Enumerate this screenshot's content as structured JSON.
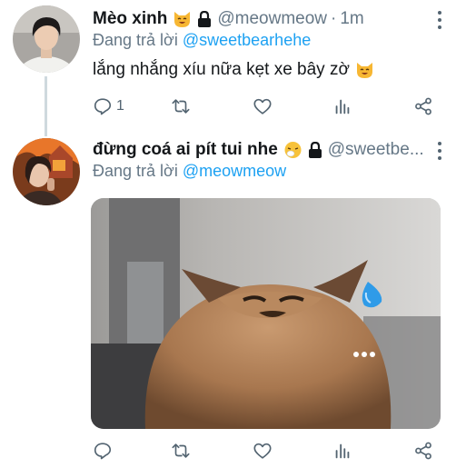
{
  "tweets": [
    {
      "author_name": "Mèo xinh",
      "author_emoji": "cat-face-icon",
      "protected_icon": "lock-icon",
      "handle": "@meowmeow",
      "separator": "·",
      "time": "1m",
      "reply_prefix": "Đang trả lời",
      "reply_to": "@sweetbearhehe",
      "text": "lắng nhắng xíu nữa kẹt xe bây zờ",
      "text_emoji": "cat-face-icon",
      "reply_count": "1"
    },
    {
      "author_name": "đừng coá ai pít tui nhe",
      "author_emoji": "sneezing-face-icon",
      "protected_icon": "lock-icon",
      "handle": "@sweetbe...",
      "reply_prefix": "Đang trả lời",
      "reply_to": "@meowmeow",
      "media": "cat-meme-photo"
    }
  ],
  "colors": {
    "accent": "#1da1f2",
    "secondary_text": "#657786",
    "icon": "#536471",
    "thread_line": "#cfd9de"
  }
}
